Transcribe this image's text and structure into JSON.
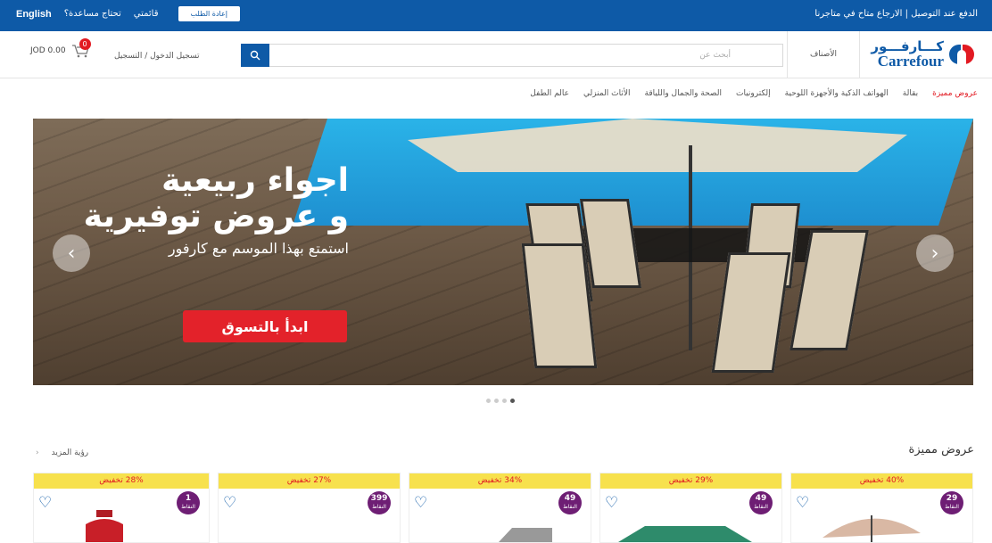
{
  "topbar": {
    "promo": "الدفع عند التوصيل | الارجاع متاح في متاجرنا",
    "language": "English",
    "help": "تحتاج مساعدة؟",
    "lists": "قائمتي",
    "reorder": "إعادة الطلب"
  },
  "header": {
    "logo_ar": "كـــارفـــور",
    "logo_en": "Carrefour",
    "categories": "الأصناف",
    "search_placeholder": "أبحث عن",
    "login": "تسجيل الدخول / التسجيل",
    "cart_total": "JOD 0.00",
    "cart_count": "0"
  },
  "nav": [
    "عروض مميزة",
    "بقالة",
    "الهواتف الذكية والأجهزة اللوحية",
    "إلكترونيات",
    "الصحة والجمال واللياقة",
    "الأثاث المنزلي",
    "عالم الطفل"
  ],
  "banner": {
    "line1": "اجواء ربيعية",
    "line2": "و عروض توفيرية",
    "line3": "استمتع بهذا الموسم مع كارفور",
    "cta": "ابدأ بالتسوق",
    "slides": 4,
    "active_slide": 4
  },
  "featured": {
    "title": "عروض مميزة",
    "see_more": "رؤية المزيد",
    "products": [
      {
        "discount": "40% تخفيض",
        "points": "29",
        "points_unit": "النقاط"
      },
      {
        "discount": "29% تخفيض",
        "points": "49",
        "points_unit": "النقاط"
      },
      {
        "discount": "34% تخفيض",
        "points": "49",
        "points_unit": "النقاط"
      },
      {
        "discount": "27% تخفيض",
        "points": "399",
        "points_unit": "النقاط"
      },
      {
        "discount": "28% تخفيض",
        "points": "1",
        "points_unit": "النقاط"
      }
    ]
  },
  "colors": {
    "brand_blue": "#0e5aa7",
    "brand_red": "#e21a22",
    "discount_bg": "#f7e14d",
    "points_bg": "#6e1e74"
  }
}
